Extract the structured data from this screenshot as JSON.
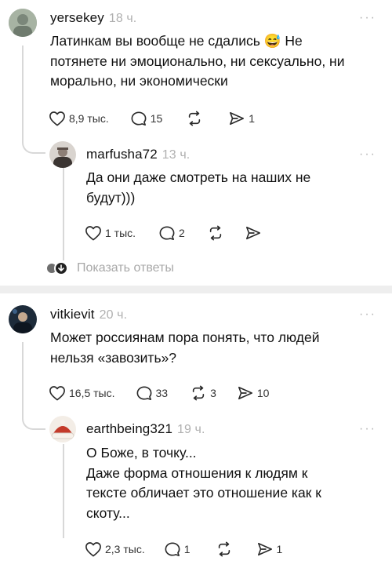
{
  "comments": [
    {
      "username": "yersekey",
      "time": "18 ч.",
      "lines": [
        "Латинкам вы вообще не сдались 😅 Не",
        "потянете ни эмоционально, ни сексуально, ни",
        "морально, ни экономически"
      ],
      "likes": "8,9 тыс.",
      "replies": "15",
      "reposts": "",
      "shares": "1"
    },
    {
      "username": "marfusha72",
      "time": "13 ч.",
      "lines": [
        "Да они даже смотреть на наших не",
        "будут)))"
      ],
      "likes": "1 тыс.",
      "replies": "2",
      "reposts": "",
      "shares": ""
    },
    {
      "username": "vitkievit",
      "time": "20 ч.",
      "lines": [
        "Может россиянам пора понять, что людей",
        "нельзя «завозить»?"
      ],
      "likes": "16,5 тыс.",
      "replies": "33",
      "reposts": "3",
      "shares": "10"
    },
    {
      "username": "earthbeing321",
      "time": "19 ч.",
      "lines": [
        "О Боже, в точку...",
        "Даже форма отношения к людям к",
        "тексте обличает это отношение как к",
        "скоту..."
      ],
      "likes": "2,3 тыс.",
      "replies": "1",
      "reposts": "",
      "shares": "1"
    }
  ],
  "show_replies_label": "Показать ответы",
  "more_glyph": "···",
  "icons": {
    "like": "heart-icon",
    "reply": "speech-bubble-icon",
    "repost": "repost-arrows-icon",
    "share": "paper-plane-icon"
  },
  "colors": {
    "text": "#111111",
    "muted": "#b0b0b0",
    "divider": "#eeeeee",
    "thread": "#d8d8d8"
  }
}
